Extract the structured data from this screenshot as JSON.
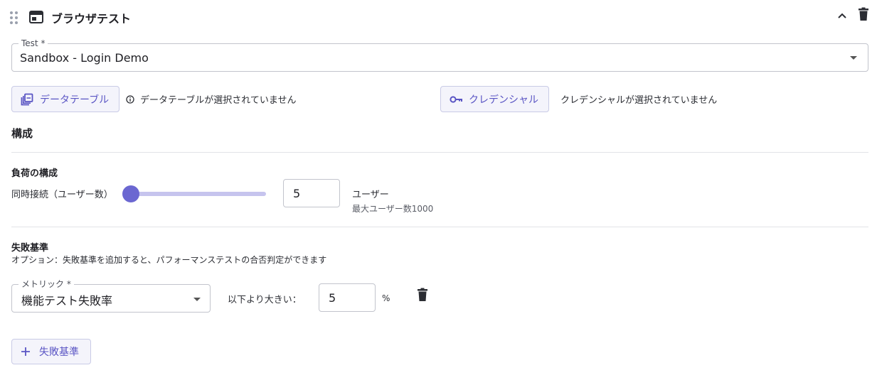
{
  "header": {
    "title": "ブラウザテスト"
  },
  "test_select": {
    "label": "Test *",
    "value": "Sandbox - Login Demo"
  },
  "data_table": {
    "button_label": "データテーブル",
    "status": "データテーブルが選択されていません"
  },
  "credential": {
    "button_label": "クレデンシャル",
    "status": "クレデンシャルが選択されていません"
  },
  "config": {
    "heading": "構成",
    "load": {
      "heading": "負荷の構成",
      "concurrency_label": "同時接続（ユーザー数）",
      "users_value": "5",
      "users_unit": "ユーザー",
      "max_note": "最大ユーザー数1000",
      "slider_fraction": 0.005
    }
  },
  "failure": {
    "heading": "失敗基準",
    "description": "オプション：失敗基準を追加すると、パフォーマンステストの合否判定ができます",
    "metric_label": "メトリック *",
    "metric_value": "機能テスト失敗率",
    "comparison_label": "以下より大きい：",
    "threshold_value": "5",
    "threshold_unit": "%",
    "add_button_label": "失敗基準"
  },
  "colors": {
    "accent": "#6b67d1",
    "button_bg": "#f4f4fb",
    "button_text": "#5a55c4"
  }
}
